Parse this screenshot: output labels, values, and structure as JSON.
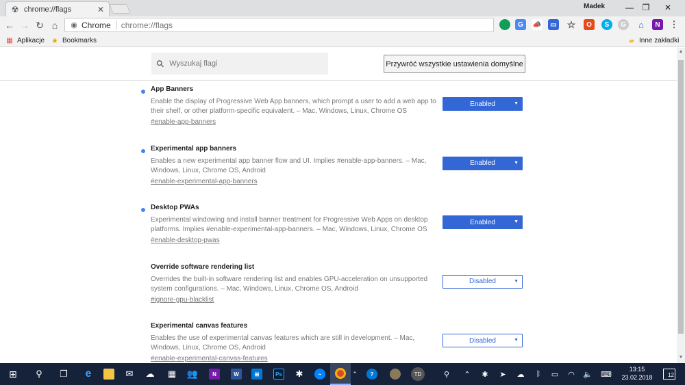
{
  "tab": {
    "title": "chrome://flags",
    "close": "✕"
  },
  "profile": {
    "name": "Madek"
  },
  "window_controls": {
    "minimize": "—",
    "restore": "❐",
    "close": "✕"
  },
  "omnibox": {
    "chip_label": "Chrome",
    "url": "chrome://flags"
  },
  "bookmarks": {
    "apps_label": "Aplikacje",
    "bookmarks_label": "Bookmarks",
    "other_label": "Inne zakładki"
  },
  "search": {
    "placeholder": "Wyszukaj flagi"
  },
  "reset_button": {
    "label": "Przywróć wszystkie ustawienia domyślne"
  },
  "flags": [
    {
      "name": "App Banners",
      "description": "Enable the display of Progressive Web App banners, which prompt a user to add a web app to their shelf, or other platform-specific equivalent. – Mac, Windows, Linux, Chrome OS",
      "hash": "#enable-app-banners",
      "state": "Enabled",
      "modified": true
    },
    {
      "name": "Experimental app banners",
      "description": "Enables a new experimental app banner flow and UI. Implies #enable-app-banners. – Mac, Windows, Linux, Chrome OS, Android",
      "hash": "#enable-experimental-app-banners",
      "state": "Enabled",
      "modified": true
    },
    {
      "name": "Desktop PWAs",
      "description": "Experimental windowing and install banner treatment for Progressive Web Apps on desktop platforms. Implies #enable-experimental-app-banners. – Mac, Windows, Linux, Chrome OS",
      "hash": "#enable-desktop-pwas",
      "state": "Enabled",
      "modified": true
    },
    {
      "name": "Override software rendering list",
      "description": "Overrides the built-in software rendering list and enables GPU-acceleration on unsupported system configurations. – Mac, Windows, Linux, Chrome OS, Android",
      "hash": "#ignore-gpu-blacklist",
      "state": "Disabled",
      "modified": false
    },
    {
      "name": "Experimental canvas features",
      "description": "Enables the use of experimental canvas features which are still in development. – Mac, Windows, Linux, Chrome OS, Android",
      "hash": "#enable-experimental-canvas-features",
      "state": "Disabled",
      "modified": false
    }
  ],
  "taskbar": {
    "avatar_initials": "TD",
    "clock_time": "13:15",
    "clock_date": "23.02.2018",
    "notification_count": "12"
  },
  "colors": {
    "accent": "#3367d6",
    "modified_dot": "#4285f4",
    "taskbar": "#16213a"
  }
}
